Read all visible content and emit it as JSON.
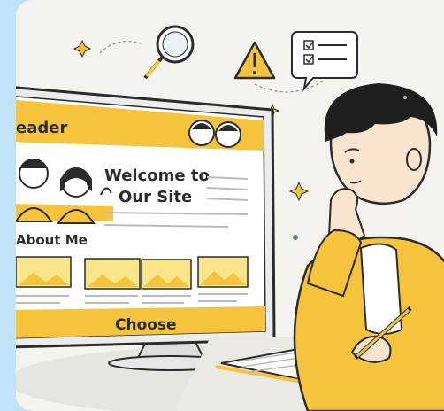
{
  "site_mockup": {
    "header_title": "eader",
    "welcome_line1": "Welcome to",
    "welcome_line2": "Our Site",
    "section_title": "About Me",
    "cta_label": "Choose"
  },
  "colors": {
    "accent_yellow": "#f6c43c",
    "light_yellow": "#fbe58b",
    "outline": "#2b2b2b",
    "background": "#f4f3ef",
    "side_band": "#bfe4f7"
  },
  "icons": [
    "magnifier-icon",
    "warning-icon",
    "checklist-icon",
    "sparkle-icon"
  ]
}
